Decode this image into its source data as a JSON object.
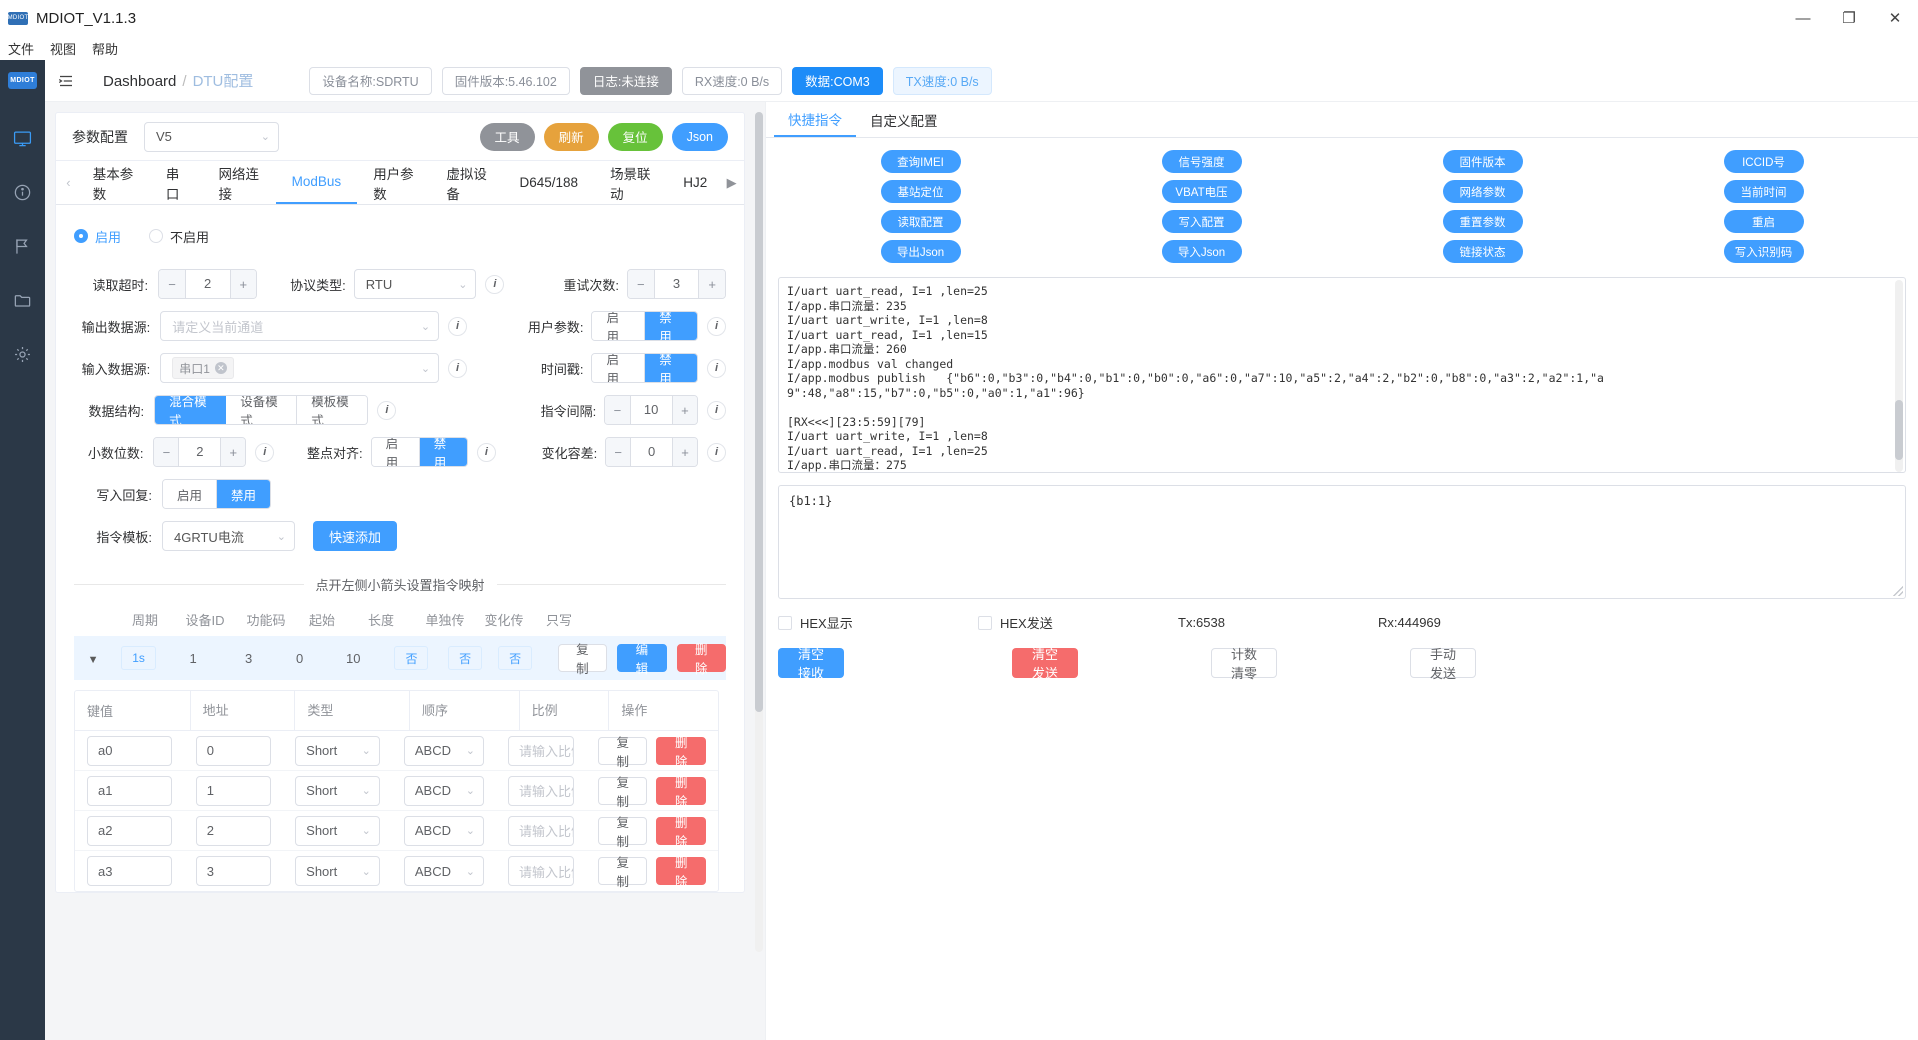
{
  "window": {
    "title": "MDIOT_V1.1.3",
    "logo_text": "MDIOT",
    "minimize": "—",
    "maximize": "❐",
    "close": "✕"
  },
  "menubar": {
    "items": [
      "文件",
      "视图",
      "帮助"
    ]
  },
  "rail": {
    "logo": "MDIOT"
  },
  "topbar": {
    "breadcrumb_root": "Dashboard",
    "breadcrumb_sep": "/",
    "breadcrumb_current": "DTU配置",
    "chips": [
      {
        "label": "设备名称:SDRTU",
        "style": "default"
      },
      {
        "label": "固件版本:5.46.102",
        "style": "default"
      },
      {
        "label": "日志:未连接",
        "style": "gray"
      },
      {
        "label": "RX速度:0 B/s",
        "style": "default"
      },
      {
        "label": "数据:COM3",
        "style": "blue"
      },
      {
        "label": "TX速度:0 B/s",
        "style": "lightblue"
      }
    ]
  },
  "config_card": {
    "title": "参数配置",
    "version_select": "V5",
    "buttons": [
      {
        "label": "工具",
        "color": "gray"
      },
      {
        "label": "刷新",
        "color": "orange"
      },
      {
        "label": "复位",
        "color": "green"
      },
      {
        "label": "Json",
        "color": "blue"
      }
    ]
  },
  "tabs": {
    "prev_arrow": "‹",
    "next_arrow": "▶",
    "items": [
      "基本参数",
      "串口",
      "网络连接",
      "ModBus",
      "用户参数",
      "虚拟设备",
      "D645/188",
      "场景联动",
      "HJ2"
    ],
    "active": "ModBus"
  },
  "form": {
    "enable_radio": {
      "on": "启用",
      "off": "不启用",
      "selected": "启用"
    },
    "read_timeout": {
      "label": "读取超时:",
      "value": "2",
      "minus": "−",
      "plus": "+"
    },
    "protocol_type": {
      "label": "协议类型:",
      "value": "RTU"
    },
    "retry_count": {
      "label": "重试次数:",
      "value": "3",
      "minus": "−",
      "plus": "+"
    },
    "output_source": {
      "label": "输出数据源:",
      "placeholder": "请定义当前通道"
    },
    "user_param": {
      "label": "用户参数:",
      "on": "启用",
      "off": "禁用",
      "selected": "禁用"
    },
    "input_source": {
      "label": "输入数据源:",
      "tag": "串口1"
    },
    "timestamp": {
      "label": "时间戳:",
      "on": "启用",
      "off": "禁用",
      "selected": "禁用"
    },
    "data_struct": {
      "label": "数据结构:",
      "options": [
        "混合模式",
        "设备模式",
        "模板模式"
      ],
      "selected": "混合模式"
    },
    "cmd_interval": {
      "label": "指令间隔:",
      "value": "10",
      "minus": "−",
      "plus": "+"
    },
    "decimals": {
      "label": "小数位数:",
      "value": "2",
      "minus": "−",
      "plus": "+"
    },
    "hour_align": {
      "label": "整点对齐:",
      "on": "启用",
      "off": "禁用",
      "selected": "禁用"
    },
    "change_tol": {
      "label": "变化容差:",
      "value": "0",
      "minus": "−",
      "plus": "+"
    },
    "write_reply": {
      "label": "写入回复:",
      "on": "启用",
      "off": "禁用",
      "selected": "禁用"
    },
    "cmd_template": {
      "label": "指令模板:",
      "value": "4GRTU电流",
      "add_button": "快速添加"
    },
    "hint": "点开左侧小箭头设置指令映射"
  },
  "cmd_table": {
    "headers": [
      "周期",
      "设备ID",
      "功能码",
      "起始",
      "长度",
      "单独传",
      "变化传",
      "只写"
    ],
    "rows": [
      {
        "expand": "▼",
        "period": "1s",
        "device_id": "1",
        "func_code": "3",
        "start": "0",
        "length": "10",
        "single": "否",
        "change": "否",
        "write_only": "否",
        "copy": "复制",
        "edit": "编辑",
        "delete": "删除"
      }
    ]
  },
  "key_table": {
    "headers": [
      "键值",
      "地址",
      "类型",
      "顺序",
      "比例",
      "操作"
    ],
    "ratio_placeholder": "请输入比例",
    "copy": "复制",
    "delete": "删除",
    "rows": [
      {
        "key": "a0",
        "addr": "0",
        "type": "Short",
        "order": "ABCD"
      },
      {
        "key": "a1",
        "addr": "1",
        "type": "Short",
        "order": "ABCD"
      },
      {
        "key": "a2",
        "addr": "2",
        "type": "Short",
        "order": "ABCD"
      },
      {
        "key": "a3",
        "addr": "3",
        "type": "Short",
        "order": "ABCD"
      }
    ]
  },
  "right": {
    "tabs": {
      "items": [
        "快捷指令",
        "自定义配置"
      ],
      "active": "快捷指令"
    },
    "commands": [
      "查询IMEI",
      "信号强度",
      "固件版本",
      "ICCID号",
      "基站定位",
      "VBAT电压",
      "网络参数",
      "当前时间",
      "读取配置",
      "写入配置",
      "重置参数",
      "重启",
      "导出Json",
      "导入Json",
      "链接状态",
      "写入识别码"
    ],
    "log": "I/uart uart_read, I=1 ,len=25\nI/app.串口流量：235\nI/uart uart_write, I=1 ,len=8\nI/uart uart_read, I=1 ,len=15\nI/app.串口流量：260\nI/app.modbus val changed\nI/app.modbus publish   {\"b6\":0,\"b3\":0,\"b4\":0,\"b1\":0,\"b0\":0,\"a6\":0,\"a7\":10,\"a5\":2,\"a4\":2,\"b2\":0,\"b8\":0,\"a3\":2,\"a2\":1,\"a\n9\":48,\"a8\":15,\"b7\":0,\"b5\":0,\"a0\":1,\"a1\":96}\n\n[RX<<<][23:5:59][79]\nI/uart uart_write, I=1 ,len=8\nI/uart uart_read, I=1 ,len=25\nI/app.串口流量：275",
    "send_value": "{b1:1}",
    "hex_display": "HEX显示",
    "hex_send": "HEX发送",
    "tx_counter": "Tx:6538",
    "rx_counter": "Rx:444969",
    "buttons": {
      "clear_recv": "清空接收",
      "clear_send": "清空发送",
      "counter_reset": "计数清零",
      "manual_send": "手动发送"
    }
  },
  "colors": {
    "primary": "#409eff",
    "danger": "#f56c6c",
    "warning": "#e6a23c",
    "success": "#67c23a",
    "info": "#909399"
  }
}
